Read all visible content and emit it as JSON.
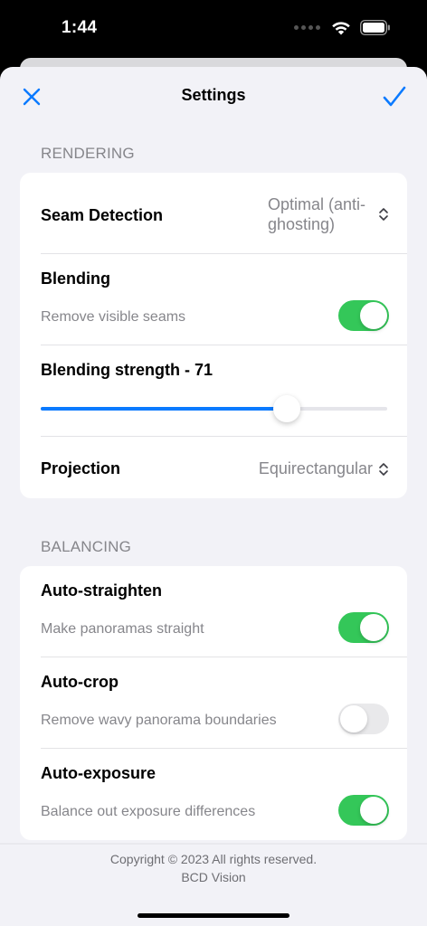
{
  "status_bar": {
    "time": "1:44"
  },
  "nav": {
    "title": "Settings",
    "close_icon": "close-icon",
    "done_icon": "checkmark-icon"
  },
  "rendering": {
    "header": "RENDERING",
    "seam_detection": {
      "label": "Seam Detection",
      "value": "Optimal (anti-ghosting)"
    },
    "blending": {
      "label": "Blending",
      "subtitle": "Remove visible seams",
      "enabled": true
    },
    "blending_strength": {
      "label": "Blending strength - 71",
      "value": 71,
      "min": 0,
      "max": 100
    },
    "projection": {
      "label": "Projection",
      "value": "Equirectangular"
    }
  },
  "balancing": {
    "header": "BALANCING",
    "auto_straighten": {
      "label": "Auto-straighten",
      "subtitle": "Make panoramas straight",
      "enabled": true
    },
    "auto_crop": {
      "label": "Auto-crop",
      "subtitle": "Remove wavy panorama boundaries",
      "enabled": false
    },
    "auto_exposure": {
      "label": "Auto-exposure",
      "subtitle": "Balance out exposure differences",
      "enabled": true
    }
  },
  "footer": {
    "line1": "Copyright © 2023 All rights reserved.",
    "line2": "BCD Vision"
  },
  "colors": {
    "accent": "#0A7AFF",
    "toggle_on": "#34C759",
    "toggle_off": "#E9E9EB",
    "background": "#F2F2F7",
    "secondary_text": "#86868B"
  }
}
